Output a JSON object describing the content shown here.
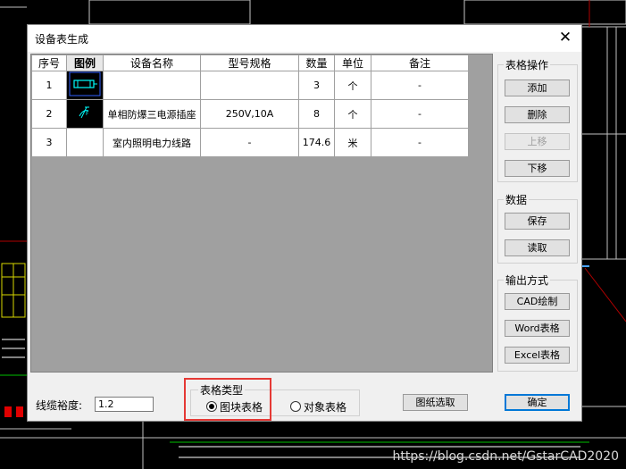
{
  "dialog": {
    "title": "设备表生成",
    "close_icon": "close-icon"
  },
  "table": {
    "headers": [
      "序号",
      "图例",
      "设备名称",
      "型号规格",
      "数量",
      "单位",
      "备注"
    ],
    "rows": [
      {
        "seq": "1",
        "legend_icon": "lighting-symbol-icon",
        "name": "",
        "spec": "",
        "qty": "3",
        "unit": "个",
        "note": "-"
      },
      {
        "seq": "2",
        "legend_icon": "socket-symbol-icon",
        "name": "单相防爆三电源插座",
        "spec": "250V,10A",
        "qty": "8",
        "unit": "个",
        "note": "-"
      },
      {
        "seq": "3",
        "legend_icon": "",
        "name": "室内照明电力线路",
        "spec": "-",
        "qty": "174.6",
        "unit": "米",
        "note": "-"
      }
    ]
  },
  "table_ops": {
    "label": "表格操作",
    "add": "添加",
    "delete": "删除",
    "move_up": "上移",
    "move_down": "下移"
  },
  "data_ops": {
    "label": "数据",
    "save": "保存",
    "load": "读取"
  },
  "output": {
    "label": "输出方式",
    "cad": "CAD绘制",
    "word": "Word表格",
    "excel": "Excel表格"
  },
  "cable_margin": {
    "label": "线缆裕度:",
    "value": "1.2"
  },
  "table_type": {
    "label": "表格类型",
    "block_table": "图块表格",
    "object_table": "对象表格",
    "selected": "图块表格"
  },
  "drawing_select": "图纸选取",
  "ok": "确定",
  "watermark": "https://blog.csdn.net/GstarCAD2020",
  "colors": {
    "cad_background": "#000000",
    "highlight_frame": "#e53935",
    "cad_icon": "#00ffff"
  }
}
